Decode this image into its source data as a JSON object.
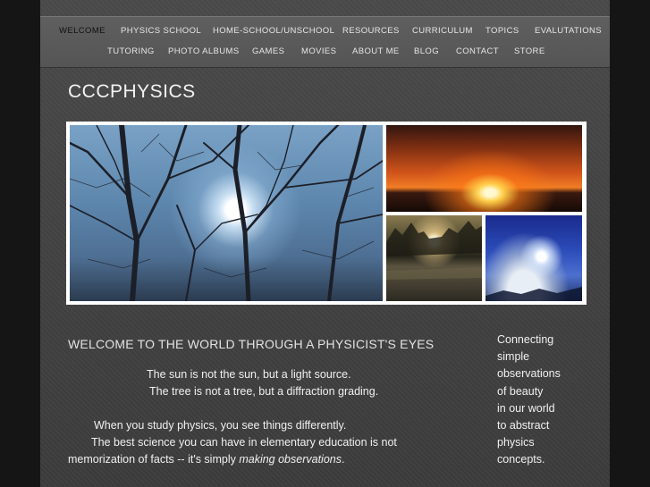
{
  "nav": {
    "row1": [
      "Welcome",
      "Physics School",
      "Home-School/Unschool",
      "Resources",
      "Curriculum",
      "Topics",
      "Evalutations"
    ],
    "row2": [
      "Tutoring",
      "Photo Albums",
      "Games",
      "Movies",
      "About Me",
      "Blog",
      "Contact",
      "Store"
    ],
    "active": "Welcome"
  },
  "site": {
    "title": "CCCPHYSICS"
  },
  "main": {
    "heading": "Welcome to the world through a physicist's eyes",
    "line1": "The sun is not the sun, but a light source.",
    "line2": "The tree is not a tree, but a diffraction grading.",
    "line3": "When you study physics, you see things differently.",
    "line4": "The best science you can have in elementary education is not",
    "line5_prefix": "memorization of facts -- it's simply ",
    "line5_emphasis": "making observations",
    "line5_suffix": "."
  },
  "sidebar": {
    "lines": [
      "Connecting",
      "simple",
      "observations",
      "of beauty",
      "in our world",
      "to abstract",
      "physics",
      "concepts."
    ]
  },
  "colors": {
    "page_bg": "#151515",
    "content_bg": "#444444",
    "nav_bg": "#5a5a5a",
    "text": "#f0f0f0",
    "active_nav": "#111111"
  }
}
